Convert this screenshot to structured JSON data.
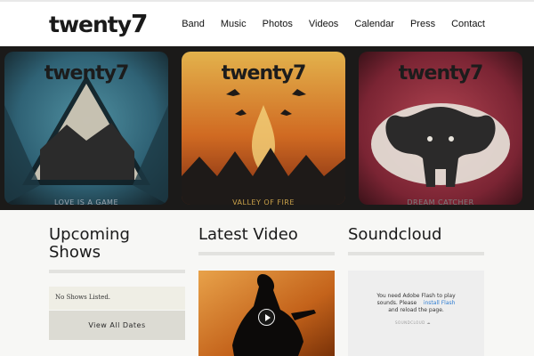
{
  "header": {
    "logo_text": "twenty",
    "logo_seven": "7",
    "nav": [
      "Band",
      "Music",
      "Photos",
      "Videos",
      "Calendar",
      "Press",
      "Contact"
    ]
  },
  "albums": [
    {
      "logo": "twenty7",
      "title": "LOVE IS A GAME"
    },
    {
      "logo": "twenty7",
      "title": "VALLEY OF FIRE"
    },
    {
      "logo": "twenty7",
      "title": "DREAM CATCHER"
    }
  ],
  "shows": {
    "title_line1": "Upcoming",
    "title_line2": "Shows",
    "empty_text": "No Shows Listed.",
    "button_label": "View All Dates"
  },
  "video": {
    "title": "Latest Video"
  },
  "soundcloud": {
    "title": "Soundcloud",
    "line1": "You need Adobe Flash to play",
    "line2_prefix": "sounds. Please",
    "link_text": "install Flash",
    "line3": "and reload the page.",
    "brand": "SOUNDCLOUD"
  },
  "colors": {
    "accent_link": "#2e7cd1",
    "banner_bg": "#1b1a19"
  }
}
